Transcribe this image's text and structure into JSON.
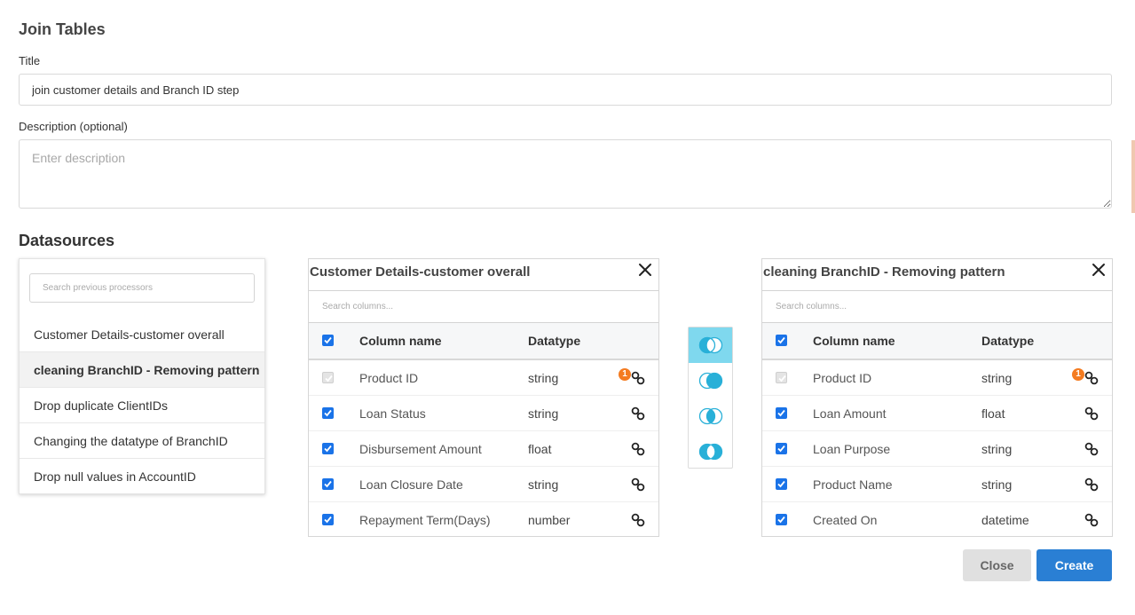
{
  "heading": "Join Tables",
  "title_label": "Title",
  "title_value": "join customer details and Branch ID step",
  "description_label": "Description (optional)",
  "description_placeholder": "Enter description",
  "datasources_label": "Datasources",
  "processors": {
    "search_placeholder": "Search previous processors",
    "items": [
      "Customer Details-customer overall",
      "cleaning BranchID - Removing pattern",
      "Drop duplicate ClientIDs",
      "Changing the datatype of BranchID",
      "Drop null values in AccountID"
    ],
    "active_index": 1
  },
  "left_table": {
    "title": "Customer Details-customer overall",
    "search_placeholder": "Search columns...",
    "header": {
      "name": "Column name",
      "type": "Datatype"
    },
    "badge": "1",
    "rows": [
      {
        "name": "Product ID",
        "type": "string"
      },
      {
        "name": "Loan Status",
        "type": "string"
      },
      {
        "name": "Disbursement Amount",
        "type": "float"
      },
      {
        "name": "Loan Closure Date",
        "type": "string"
      },
      {
        "name": "Repayment Term(Days)",
        "type": "number"
      }
    ]
  },
  "right_table": {
    "title": "cleaning BranchID - Removing pattern",
    "search_placeholder": "Search columns...",
    "header": {
      "name": "Column name",
      "type": "Datatype"
    },
    "badge": "1",
    "rows": [
      {
        "name": "Product ID",
        "type": "string"
      },
      {
        "name": "Loan Amount",
        "type": "float"
      },
      {
        "name": "Loan Purpose",
        "type": "string"
      },
      {
        "name": "Product Name",
        "type": "string"
      },
      {
        "name": "Created On",
        "type": "datetime"
      }
    ]
  },
  "join_types": [
    "left-join-icon",
    "right-join-icon",
    "inner-join-icon",
    "outer-join-icon"
  ],
  "active_join_index": 0,
  "buttons": {
    "close": "Close",
    "create": "Create"
  },
  "colors": {
    "primary": "#2a7fd4",
    "checkbox": "#1a73e8",
    "join_active": "#7fd8ee",
    "join_icon": "#29b0d8",
    "badge": "#f47b20"
  }
}
